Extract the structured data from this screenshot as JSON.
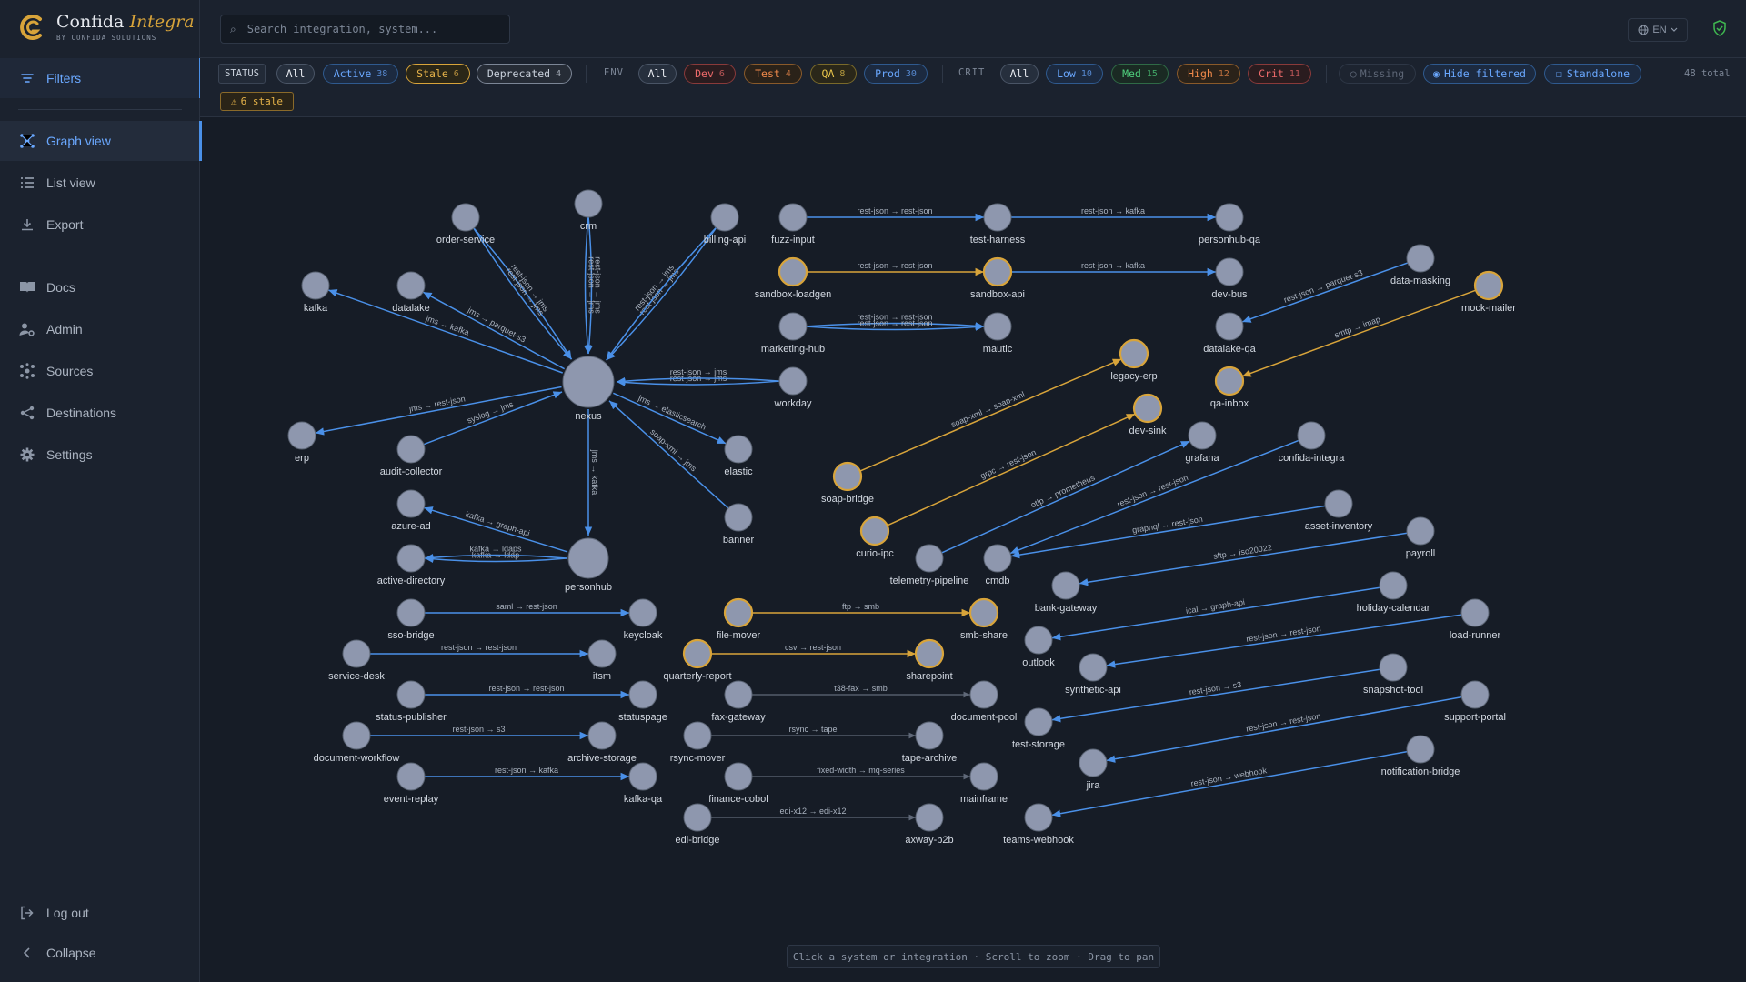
{
  "brand": {
    "name": "Confida",
    "product": "Integra",
    "tagline": "BY CONFIDA SOLUTIONS"
  },
  "search": {
    "placeholder": "Search integration, system..."
  },
  "language": {
    "label": "EN"
  },
  "sidebar": {
    "filters_label": "Filters",
    "items": [
      {
        "label": "Graph view",
        "icon": "graph-icon"
      },
      {
        "label": "List view",
        "icon": "list-icon"
      },
      {
        "label": "Export",
        "icon": "download-icon"
      },
      {
        "label": "Docs",
        "icon": "book-icon"
      },
      {
        "label": "Admin",
        "icon": "user-gear-icon"
      },
      {
        "label": "Sources",
        "icon": "sources-icon"
      },
      {
        "label": "Destinations",
        "icon": "share-icon"
      },
      {
        "label": "Settings",
        "icon": "gear-icon"
      }
    ],
    "logout_label": "Log out",
    "collapse_label": "Collapse"
  },
  "filters": {
    "status_label": "STATUS",
    "status": [
      {
        "label": "All"
      },
      {
        "label": "Active",
        "count": "38"
      },
      {
        "label": "Stale",
        "count": "6"
      },
      {
        "label": "Deprecated",
        "count": "4"
      }
    ],
    "env_label": "ENV",
    "env": [
      {
        "label": "All"
      },
      {
        "label": "Dev",
        "count": "6"
      },
      {
        "label": "Test",
        "count": "4"
      },
      {
        "label": "QA",
        "count": "8"
      },
      {
        "label": "Prod",
        "count": "30"
      }
    ],
    "crit_label": "CRIT",
    "crit": [
      {
        "label": "All"
      },
      {
        "label": "Low",
        "count": "10"
      },
      {
        "label": "Med",
        "count": "15"
      },
      {
        "label": "High",
        "count": "12"
      },
      {
        "label": "Crit",
        "count": "11"
      }
    ],
    "missing_label": "Missing",
    "hide_filtered_label": "Hide filtered",
    "standalone_label": "Standalone",
    "total_label": "48 total",
    "stale_badge": "6 stale"
  },
  "colors": {
    "accent": "#4a90e8",
    "stale": "#d8a43a",
    "node": "#8e97ae",
    "edge_active": "#4a90e8",
    "edge_stale": "#d8a43a",
    "edge_deprecated": "#5f6878"
  },
  "graph": {
    "nodes": [
      {
        "id": "nexus",
        "label": "nexus"
      },
      {
        "id": "order-service",
        "label": "order-service"
      },
      {
        "id": "crm",
        "label": "crm"
      },
      {
        "id": "billing-api",
        "label": "billing-api"
      },
      {
        "id": "kafka",
        "label": "kafka"
      },
      {
        "id": "datalake",
        "label": "datalake"
      },
      {
        "id": "workday",
        "label": "workday"
      },
      {
        "id": "erp",
        "label": "erp"
      },
      {
        "id": "audit-collector",
        "label": "audit-collector"
      },
      {
        "id": "elastic",
        "label": "elastic"
      },
      {
        "id": "banner",
        "label": "banner"
      },
      {
        "id": "personhub",
        "label": "personhub"
      },
      {
        "id": "azure-ad",
        "label": "azure-ad"
      },
      {
        "id": "active-directory",
        "label": "active-directory"
      },
      {
        "id": "sso-bridge",
        "label": "sso-bridge"
      },
      {
        "id": "keycloak",
        "label": "keycloak"
      },
      {
        "id": "service-desk",
        "label": "service-desk"
      },
      {
        "id": "itsm",
        "label": "itsm"
      },
      {
        "id": "status-publisher",
        "label": "status-publisher"
      },
      {
        "id": "statuspage",
        "label": "statuspage"
      },
      {
        "id": "document-workflow",
        "label": "document-workflow"
      },
      {
        "id": "archive-storage",
        "label": "archive-storage"
      },
      {
        "id": "event-replay",
        "label": "event-replay"
      },
      {
        "id": "kafka-qa",
        "label": "kafka-qa"
      },
      {
        "id": "fuzz-input",
        "label": "fuzz-input"
      },
      {
        "id": "test-harness",
        "label": "test-harness"
      },
      {
        "id": "personhub-qa",
        "label": "personhub-qa"
      },
      {
        "id": "sandbox-loadgen",
        "label": "sandbox-loadgen"
      },
      {
        "id": "sandbox-api",
        "label": "sandbox-api"
      },
      {
        "id": "dev-bus",
        "label": "dev-bus"
      },
      {
        "id": "marketing-hub",
        "label": "marketing-hub"
      },
      {
        "id": "mautic",
        "label": "mautic"
      },
      {
        "id": "data-masking",
        "label": "data-masking"
      },
      {
        "id": "datalake-qa",
        "label": "datalake-qa"
      },
      {
        "id": "mock-mailer",
        "label": "mock-mailer"
      },
      {
        "id": "qa-inbox",
        "label": "qa-inbox"
      },
      {
        "id": "legacy-erp",
        "label": "legacy-erp"
      },
      {
        "id": "dev-sink",
        "label": "dev-sink"
      },
      {
        "id": "soap-bridge",
        "label": "soap-bridge"
      },
      {
        "id": "curio-ipc",
        "label": "curio-ipc"
      },
      {
        "id": "grafana",
        "label": "grafana"
      },
      {
        "id": "confida-integra",
        "label": "confida-integra"
      },
      {
        "id": "telemetry-pipeline",
        "label": "telemetry-pipeline"
      },
      {
        "id": "cmdb",
        "label": "cmdb"
      },
      {
        "id": "asset-inventory",
        "label": "asset-inventory"
      },
      {
        "id": "payroll",
        "label": "payroll"
      },
      {
        "id": "bank-gateway",
        "label": "bank-gateway"
      },
      {
        "id": "holiday-calendar",
        "label": "holiday-calendar"
      },
      {
        "id": "outlook",
        "label": "outlook"
      },
      {
        "id": "load-runner",
        "label": "load-runner"
      },
      {
        "id": "synthetic-api",
        "label": "synthetic-api"
      },
      {
        "id": "snapshot-tool",
        "label": "snapshot-tool"
      },
      {
        "id": "test-storage",
        "label": "test-storage"
      },
      {
        "id": "support-portal",
        "label": "support-portal"
      },
      {
        "id": "jira",
        "label": "jira"
      },
      {
        "id": "notification-bridge",
        "label": "notification-bridge"
      },
      {
        "id": "teams-webhook",
        "label": "teams-webhook"
      },
      {
        "id": "file-mover",
        "label": "file-mover"
      },
      {
        "id": "smb-share",
        "label": "smb-share"
      },
      {
        "id": "quarterly-report",
        "label": "quarterly-report"
      },
      {
        "id": "sharepoint",
        "label": "sharepoint"
      },
      {
        "id": "fax-gateway",
        "label": "fax-gateway"
      },
      {
        "id": "document-pool",
        "label": "document-pool"
      },
      {
        "id": "rsync-mover",
        "label": "rsync-mover"
      },
      {
        "id": "tape-archive",
        "label": "tape-archive"
      },
      {
        "id": "finance-cobol",
        "label": "finance-cobol"
      },
      {
        "id": "mainframe",
        "label": "mainframe"
      },
      {
        "id": "edi-bridge",
        "label": "edi-bridge"
      },
      {
        "id": "axway-b2b",
        "label": "axway-b2b"
      }
    ],
    "edges": [
      {
        "from": "order-service",
        "to": "nexus",
        "label": "rest-json → jms",
        "status": "active"
      },
      {
        "from": "order-service",
        "to": "nexus",
        "label": "rest-json → jms",
        "status": "active"
      },
      {
        "from": "crm",
        "to": "nexus",
        "label": "rest-json → jms",
        "status": "active"
      },
      {
        "from": "crm",
        "to": "nexus",
        "label": "rest-json → jms",
        "status": "active"
      },
      {
        "from": "billing-api",
        "to": "nexus",
        "label": "rest-json → jms",
        "status": "active"
      },
      {
        "from": "billing-api",
        "to": "nexus",
        "label": "rest-json → jms",
        "status": "active"
      },
      {
        "from": "nexus",
        "to": "kafka",
        "label": "jms → kafka",
        "status": "active"
      },
      {
        "from": "nexus",
        "to": "datalake",
        "label": "jms → parquet-s3",
        "status": "active"
      },
      {
        "from": "workday",
        "to": "nexus",
        "label": "rest-json → jms",
        "status": "active"
      },
      {
        "from": "workday",
        "to": "nexus",
        "label": "rest-json → jms",
        "status": "active"
      },
      {
        "from": "nexus",
        "to": "erp",
        "label": "jms → rest-json",
        "status": "active"
      },
      {
        "from": "audit-collector",
        "to": "nexus",
        "label": "syslog → jms",
        "status": "active"
      },
      {
        "from": "nexus",
        "to": "elastic",
        "label": "jms → elasticsearch",
        "status": "active"
      },
      {
        "from": "banner",
        "to": "nexus",
        "label": "soap-xml → jms",
        "status": "active"
      },
      {
        "from": "nexus",
        "to": "personhub",
        "label": "jms → kafka",
        "status": "active"
      },
      {
        "from": "personhub",
        "to": "azure-ad",
        "label": "kafka → graph-api",
        "status": "active"
      },
      {
        "from": "personhub",
        "to": "active-directory",
        "label": "kafka → ldap",
        "status": "active"
      },
      {
        "from": "personhub",
        "to": "active-directory",
        "label": "kafka → ldaps",
        "status": "active"
      },
      {
        "from": "sso-bridge",
        "to": "keycloak",
        "label": "saml → rest-json",
        "status": "active"
      },
      {
        "from": "service-desk",
        "to": "itsm",
        "label": "rest-json → rest-json",
        "status": "active"
      },
      {
        "from": "status-publisher",
        "to": "statuspage",
        "label": "rest-json → rest-json",
        "status": "active"
      },
      {
        "from": "document-workflow",
        "to": "archive-storage",
        "label": "rest-json → s3",
        "status": "active"
      },
      {
        "from": "event-replay",
        "to": "kafka-qa",
        "label": "rest-json → kafka",
        "status": "active"
      },
      {
        "from": "fuzz-input",
        "to": "test-harness",
        "label": "rest-json → rest-json",
        "status": "active"
      },
      {
        "from": "test-harness",
        "to": "personhub-qa",
        "label": "rest-json → kafka",
        "status": "active"
      },
      {
        "from": "sandbox-loadgen",
        "to": "sandbox-api",
        "label": "rest-json → rest-json",
        "status": "stale"
      },
      {
        "from": "sandbox-api",
        "to": "dev-bus",
        "label": "rest-json → kafka",
        "status": "active"
      },
      {
        "from": "marketing-hub",
        "to": "mautic",
        "label": "rest-json → rest-json",
        "status": "active"
      },
      {
        "from": "marketing-hub",
        "to": "mautic",
        "label": "rest-json → rest-json",
        "status": "active"
      },
      {
        "from": "data-masking",
        "to": "datalake-qa",
        "label": "rest-json → parquet-s3",
        "status": "active"
      },
      {
        "from": "mock-mailer",
        "to": "qa-inbox",
        "label": "smtp → imap",
        "status": "stale"
      },
      {
        "from": "soap-bridge",
        "to": "legacy-erp",
        "label": "soap-xml → soap-xml",
        "status": "stale"
      },
      {
        "from": "curio-ipc",
        "to": "dev-sink",
        "label": "grpc → rest-json",
        "status": "stale"
      },
      {
        "from": "telemetry-pipeline",
        "to": "grafana",
        "label": "otlp → prometheus",
        "status": "active"
      },
      {
        "from": "confida-integra",
        "to": "cmdb",
        "label": "rest-json → rest-json",
        "status": "active"
      },
      {
        "from": "asset-inventory",
        "to": "cmdb",
        "label": "graphql → rest-json",
        "status": "active"
      },
      {
        "from": "payroll",
        "to": "bank-gateway",
        "label": "sftp → iso20022",
        "status": "active"
      },
      {
        "from": "holiday-calendar",
        "to": "outlook",
        "label": "ical → graph-api",
        "status": "active"
      },
      {
        "from": "load-runner",
        "to": "synthetic-api",
        "label": "rest-json → rest-json",
        "status": "active"
      },
      {
        "from": "snapshot-tool",
        "to": "test-storage",
        "label": "rest-json → s3",
        "status": "active"
      },
      {
        "from": "support-portal",
        "to": "jira",
        "label": "rest-json → rest-json",
        "status": "active"
      },
      {
        "from": "notification-bridge",
        "to": "teams-webhook",
        "label": "rest-json → webhook",
        "status": "active"
      },
      {
        "from": "file-mover",
        "to": "smb-share",
        "label": "ftp → smb",
        "status": "stale"
      },
      {
        "from": "quarterly-report",
        "to": "sharepoint",
        "label": "csv → rest-json",
        "status": "stale"
      },
      {
        "from": "fax-gateway",
        "to": "document-pool",
        "label": "t38-fax → smb",
        "status": "deprecated"
      },
      {
        "from": "rsync-mover",
        "to": "tape-archive",
        "label": "rsync → tape",
        "status": "deprecated"
      },
      {
        "from": "finance-cobol",
        "to": "mainframe",
        "label": "fixed-width → mq-series",
        "status": "deprecated"
      },
      {
        "from": "edi-bridge",
        "to": "axway-b2b",
        "label": "edi-x12 → edi-x12",
        "status": "deprecated"
      }
    ]
  },
  "hint": "Click a system or integration · Scroll to zoom · Drag to pan"
}
